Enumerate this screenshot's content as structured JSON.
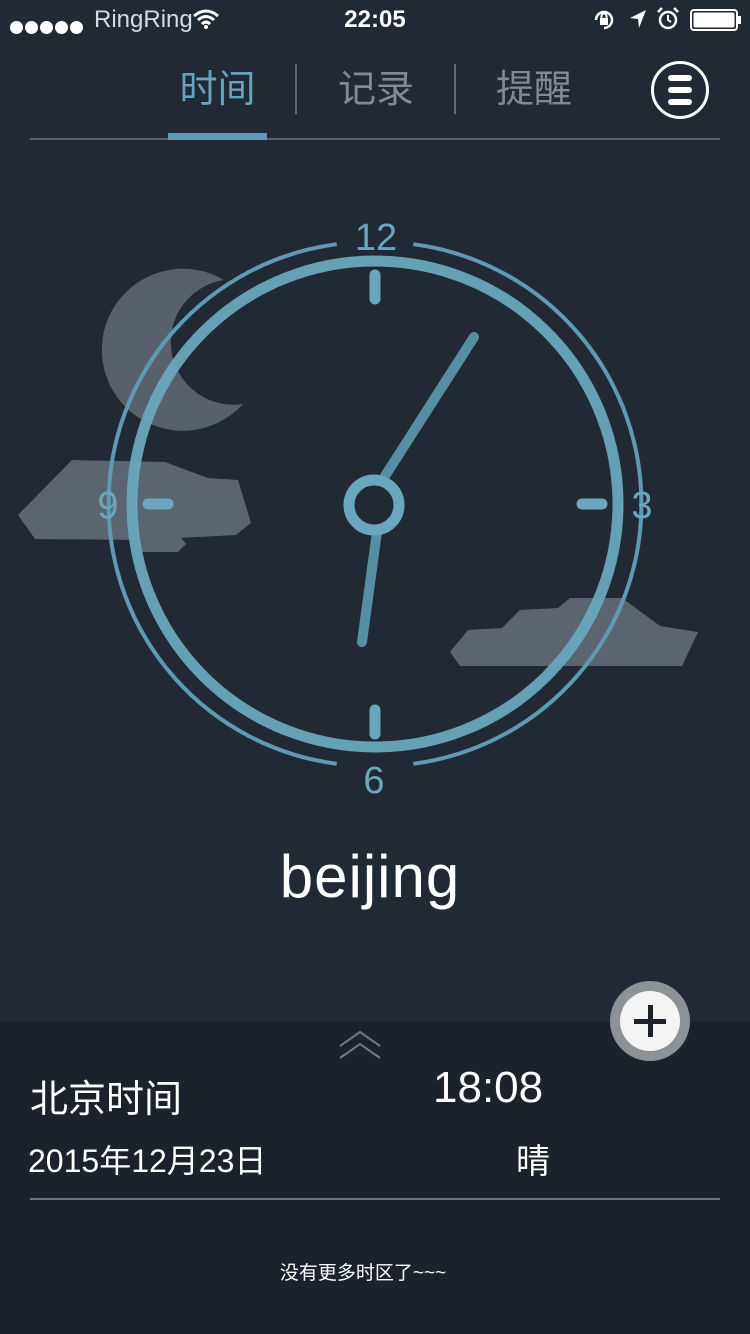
{
  "status_bar": {
    "carrier": "RingRing",
    "time": "22:05"
  },
  "tabs": [
    {
      "label": "时间",
      "active": true
    },
    {
      "label": "记录",
      "active": false
    },
    {
      "label": "提醒",
      "active": false
    }
  ],
  "clock": {
    "numbers": {
      "n12": "12",
      "n3": "3",
      "n6": "6",
      "n9": "9"
    },
    "hour_hand_time": "18:08",
    "city": "beijing",
    "weather_scene": "night-crescent-moon-clouds"
  },
  "zone": {
    "name": "北京时间",
    "time": "18:08",
    "date": "2015年12月23日",
    "weather": "晴"
  },
  "footer_text": "没有更多时区了~~~",
  "colors": {
    "background": "#212a34",
    "panel": "#1b222b",
    "accent": "#66a3bc",
    "inactive_tab": "#7f8a94"
  }
}
